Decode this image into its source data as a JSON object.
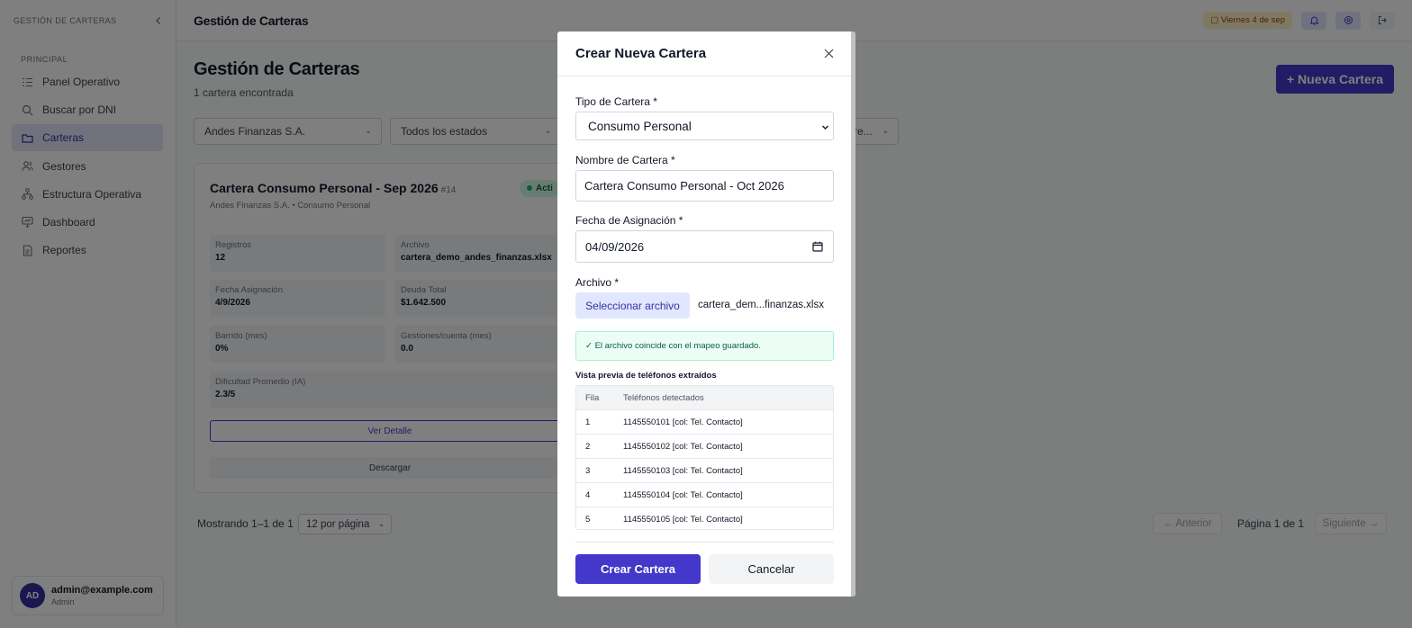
{
  "sidebar": {
    "brand": "GESTIÓN DE CARTERAS",
    "section": "PRINCIPAL",
    "items": [
      {
        "label": "Panel Operativo",
        "icon": "list-icon"
      },
      {
        "label": "Buscar por DNI",
        "icon": "search-icon"
      },
      {
        "label": "Carteras",
        "icon": "folder-icon",
        "active": true
      },
      {
        "label": "Gestores",
        "icon": "users-icon"
      },
      {
        "label": "Estructura Operativa",
        "icon": "org-icon"
      },
      {
        "label": "Dashboard",
        "icon": "monitor-icon"
      },
      {
        "label": "Reportes",
        "icon": "report-icon"
      }
    ],
    "user": {
      "initials": "AD",
      "email": "admin@example.com",
      "role": "Admin"
    }
  },
  "topbar": {
    "title": "Gestión de Carteras",
    "date": "Viernes 4 de sep"
  },
  "main": {
    "title": "Gestión de Carteras",
    "subtitle": "1 cartera encontrada",
    "new_button": "+ Nueva Cartera",
    "filters": [
      "Andes Finanzas S.A.",
      "Todos los estados",
      "re..."
    ],
    "card": {
      "title": "Cartera Consumo Personal - Sep 2026",
      "id": "#14",
      "status": "Acti",
      "subtitle": "Andes Finanzas S.A. • Consumo Personal",
      "stats": [
        {
          "label": "Registros",
          "value": "12"
        },
        {
          "label": "Archivo",
          "value": "cartera_demo_andes_finanzas.xlsx"
        },
        {
          "label": "Fecha Asignación",
          "value": "4/9/2026"
        },
        {
          "label": "Deuda Total",
          "value": "$1.642.500"
        },
        {
          "label": "Barrido (mes)",
          "value": "0%"
        },
        {
          "label": "Gestiones/cuenta (mes)",
          "value": "0.0"
        },
        {
          "label": "Dificultad Promedio (IA)",
          "value": "2.3/5"
        }
      ],
      "detail_button": "Ver Detalle",
      "download_button": "Descargar"
    },
    "pagination": {
      "showing": "Mostrando 1–1 de 1",
      "per_page": "12 por página",
      "prev": "← Anterior",
      "info": "Página 1 de 1",
      "next": "Siguiente →"
    }
  },
  "modal": {
    "title": "Crear Nueva Cartera",
    "tipo_label": "Tipo de Cartera *",
    "tipo_value": "Consumo Personal",
    "nombre_label": "Nombre de Cartera *",
    "nombre_value": "Cartera Consumo Personal - Oct 2026",
    "fecha_label": "Fecha de Asignación *",
    "fecha_value": "04/09/2026",
    "archivo_label": "Archivo *",
    "file_button": "Seleccionar archivo",
    "file_name": "cartera_dem...finanzas.xlsx",
    "match_message": "✓ El archivo coincide con el mapeo guardado.",
    "preview_title": "Vista previa de teléfonos extraídos",
    "preview_headers": [
      "Fila",
      "Teléfonos detectados"
    ],
    "preview_rows": [
      {
        "row": "1",
        "phones": "1145550101 [col: Tel. Contacto]"
      },
      {
        "row": "2",
        "phones": "1145550102 [col: Tel. Contacto]"
      },
      {
        "row": "3",
        "phones": "1145550103 [col: Tel. Contacto]"
      },
      {
        "row": "4",
        "phones": "1145550104 [col: Tel. Contacto]"
      },
      {
        "row": "5",
        "phones": "1145550105 [col: Tel. Contacto]"
      }
    ],
    "create_button": "Crear Cartera",
    "cancel_button": "Cancelar"
  }
}
